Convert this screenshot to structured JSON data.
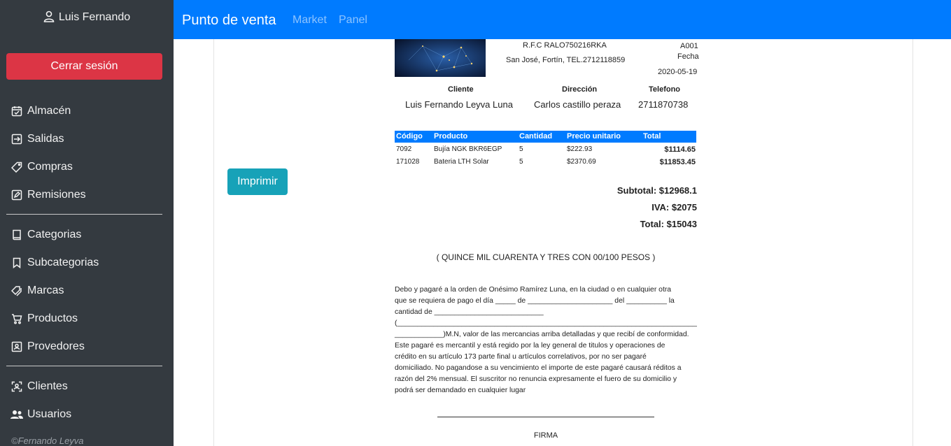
{
  "sidebar": {
    "user_name": "Luis Fernando",
    "logout_label": "Cerrar sesión",
    "group1": [
      {
        "label": "Almacén",
        "icon": "calendar-icon"
      },
      {
        "label": "Salidas",
        "icon": "exit-icon"
      },
      {
        "label": "Compras",
        "icon": "tag-icon"
      },
      {
        "label": "Remisiones",
        "icon": "edit-icon"
      }
    ],
    "group2": [
      {
        "label": "Categorias",
        "icon": "book-icon"
      },
      {
        "label": "Subcategorias",
        "icon": "bookmark-icon"
      },
      {
        "label": "Marcas",
        "icon": "tags-icon"
      },
      {
        "label": "Productos",
        "icon": "cart-icon"
      },
      {
        "label": "Provedores",
        "icon": "contact-icon"
      }
    ],
    "group3": [
      {
        "label": "Clientes",
        "icon": "client-icon"
      },
      {
        "label": "Usuarios",
        "icon": "users-icon"
      }
    ],
    "footer": "©Fernando Leyva"
  },
  "navbar": {
    "brand": "Punto de venta",
    "links": [
      "Market",
      "Panel"
    ]
  },
  "main": {
    "print_label": "Imprimir"
  },
  "invoice": {
    "rfc": "R.F.C RALO750216RKA",
    "address": "San José, Fortín, TEL.2712118859",
    "folio": "A001",
    "fecha_label": "Fecha",
    "fecha": "2020-05-19",
    "cliente_label": "Cliente",
    "direccion_label": "Dirección",
    "telefono_label": "Telefono",
    "cliente": "Luis Fernando Leyva Luna",
    "direccion": "Carlos castillo peraza",
    "telefono": "2711870738",
    "columns": [
      "Código",
      "Producto",
      "Cantidad",
      "Precio unitario",
      "Total"
    ],
    "rows": [
      {
        "codigo": "7092",
        "producto": "Bujía NGK BKR6EGP",
        "cantidad": "5",
        "precio": "$222.93",
        "total": "$1114.65"
      },
      {
        "codigo": "171028",
        "producto": "Bateria LTH Solar",
        "cantidad": "5",
        "precio": "$2370.69",
        "total": "$11853.45"
      }
    ],
    "subtotal": "Subtotal: $12968.1",
    "iva": "IVA: $2075",
    "total": "Total: $15043",
    "amount_words": "( QUINCE MIL CUARENTA Y TRES CON 00/100 PESOS )",
    "pagare_lines": [
      "Debo y pagaré a la orden de Onésimo Ramírez Luna, en la ciudad o en cualquier otra",
      "que se requiera de pago el día _____ de _____________________ del __________ la",
      "cantidad de ___________________________",
      "(_____________________________________________________________________________",
      "____________)M.N, valor de las mercancias arriba detalladas y que recibí de conformidad.",
      "Este pagaré es mercantil y está regido por la ley general de titulos y operaciones de",
      "crédito en su artículo 173 parte final u artículos correlativos, por no ser pagaré",
      "domiciliado. No pagandose a su vencimiento el importe de este pagaré causará réditos a",
      "razón del 2% mensual. El suscritor no renuncia expresamente el fuero de su domicilio y",
      "podrá ser demandado en cualquier lugar"
    ],
    "firma_label": "FIRMA"
  }
}
